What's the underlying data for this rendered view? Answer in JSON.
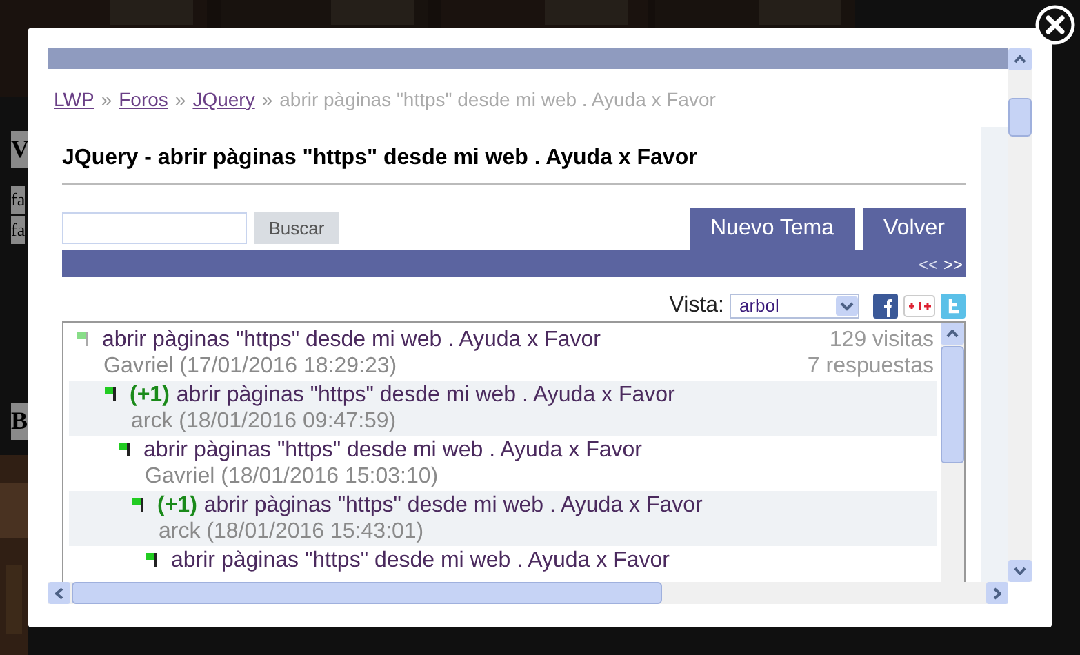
{
  "background_page": {
    "fragments": [
      {
        "text": "V",
        "kind": "heading"
      },
      {
        "text": "fa",
        "kind": "body"
      },
      {
        "text": "fa",
        "kind": "body"
      },
      {
        "text": "B",
        "kind": "heading"
      }
    ]
  },
  "breadcrumb": [
    {
      "text": "LWP",
      "kind": "link"
    },
    {
      "text": "»",
      "kind": "separator"
    },
    {
      "text": "Foros",
      "kind": "link"
    },
    {
      "text": "»",
      "kind": "separator"
    },
    {
      "text": "JQuery",
      "kind": "link"
    },
    {
      "text": "»",
      "kind": "separator"
    },
    {
      "text": "abrir pàginas \"https\" desde mi web . Ayuda x Favor",
      "kind": "current"
    }
  ],
  "title": "JQuery - abrir pàginas \"https\" desde mi web . Ayuda x Favor",
  "search": {
    "button": "Buscar"
  },
  "actions": [
    "Nuevo Tema",
    "Volver"
  ],
  "pager": {
    "prev": "<<",
    "next": ">>"
  },
  "view": {
    "label": "Vista:",
    "value": "arbol"
  },
  "thread": {
    "posts": [
      {
        "title": "abrir pàginas \"https\" desde mi web . Ayuda x Favor",
        "author": "Gavriel (17/01/2016 18:29:23)",
        "color": "#88dd88",
        "stats": [
          "129 visitas",
          "7 respuestas"
        ],
        "children": [
          {
            "score": "(+1)",
            "title": "abrir pàginas \"https\" desde mi web . Ayuda x Favor",
            "author": "arck (18/01/2016 09:47:59)",
            "color": "#22cc22",
            "children": [
              {
                "title": "abrir pàginas \"https\" desde mi web . Ayuda x Favor",
                "author": "Gavriel (18/01/2016 15:03:10)",
                "color": "#22cc22",
                "children": [
                  {
                    "score": "(+1)",
                    "title": "abrir pàginas \"https\" desde mi web . Ayuda x Favor",
                    "author": "arck (18/01/2016 15:43:01)",
                    "color": "#22cc22",
                    "children": [
                      {
                        "title": "abrir pàginas \"https\" desde mi web . Ayuda x Favor",
                        "color": "#22cc22"
                      }
                    ]
                  }
                ]
              }
            ]
          }
        ]
      }
    ]
  }
}
